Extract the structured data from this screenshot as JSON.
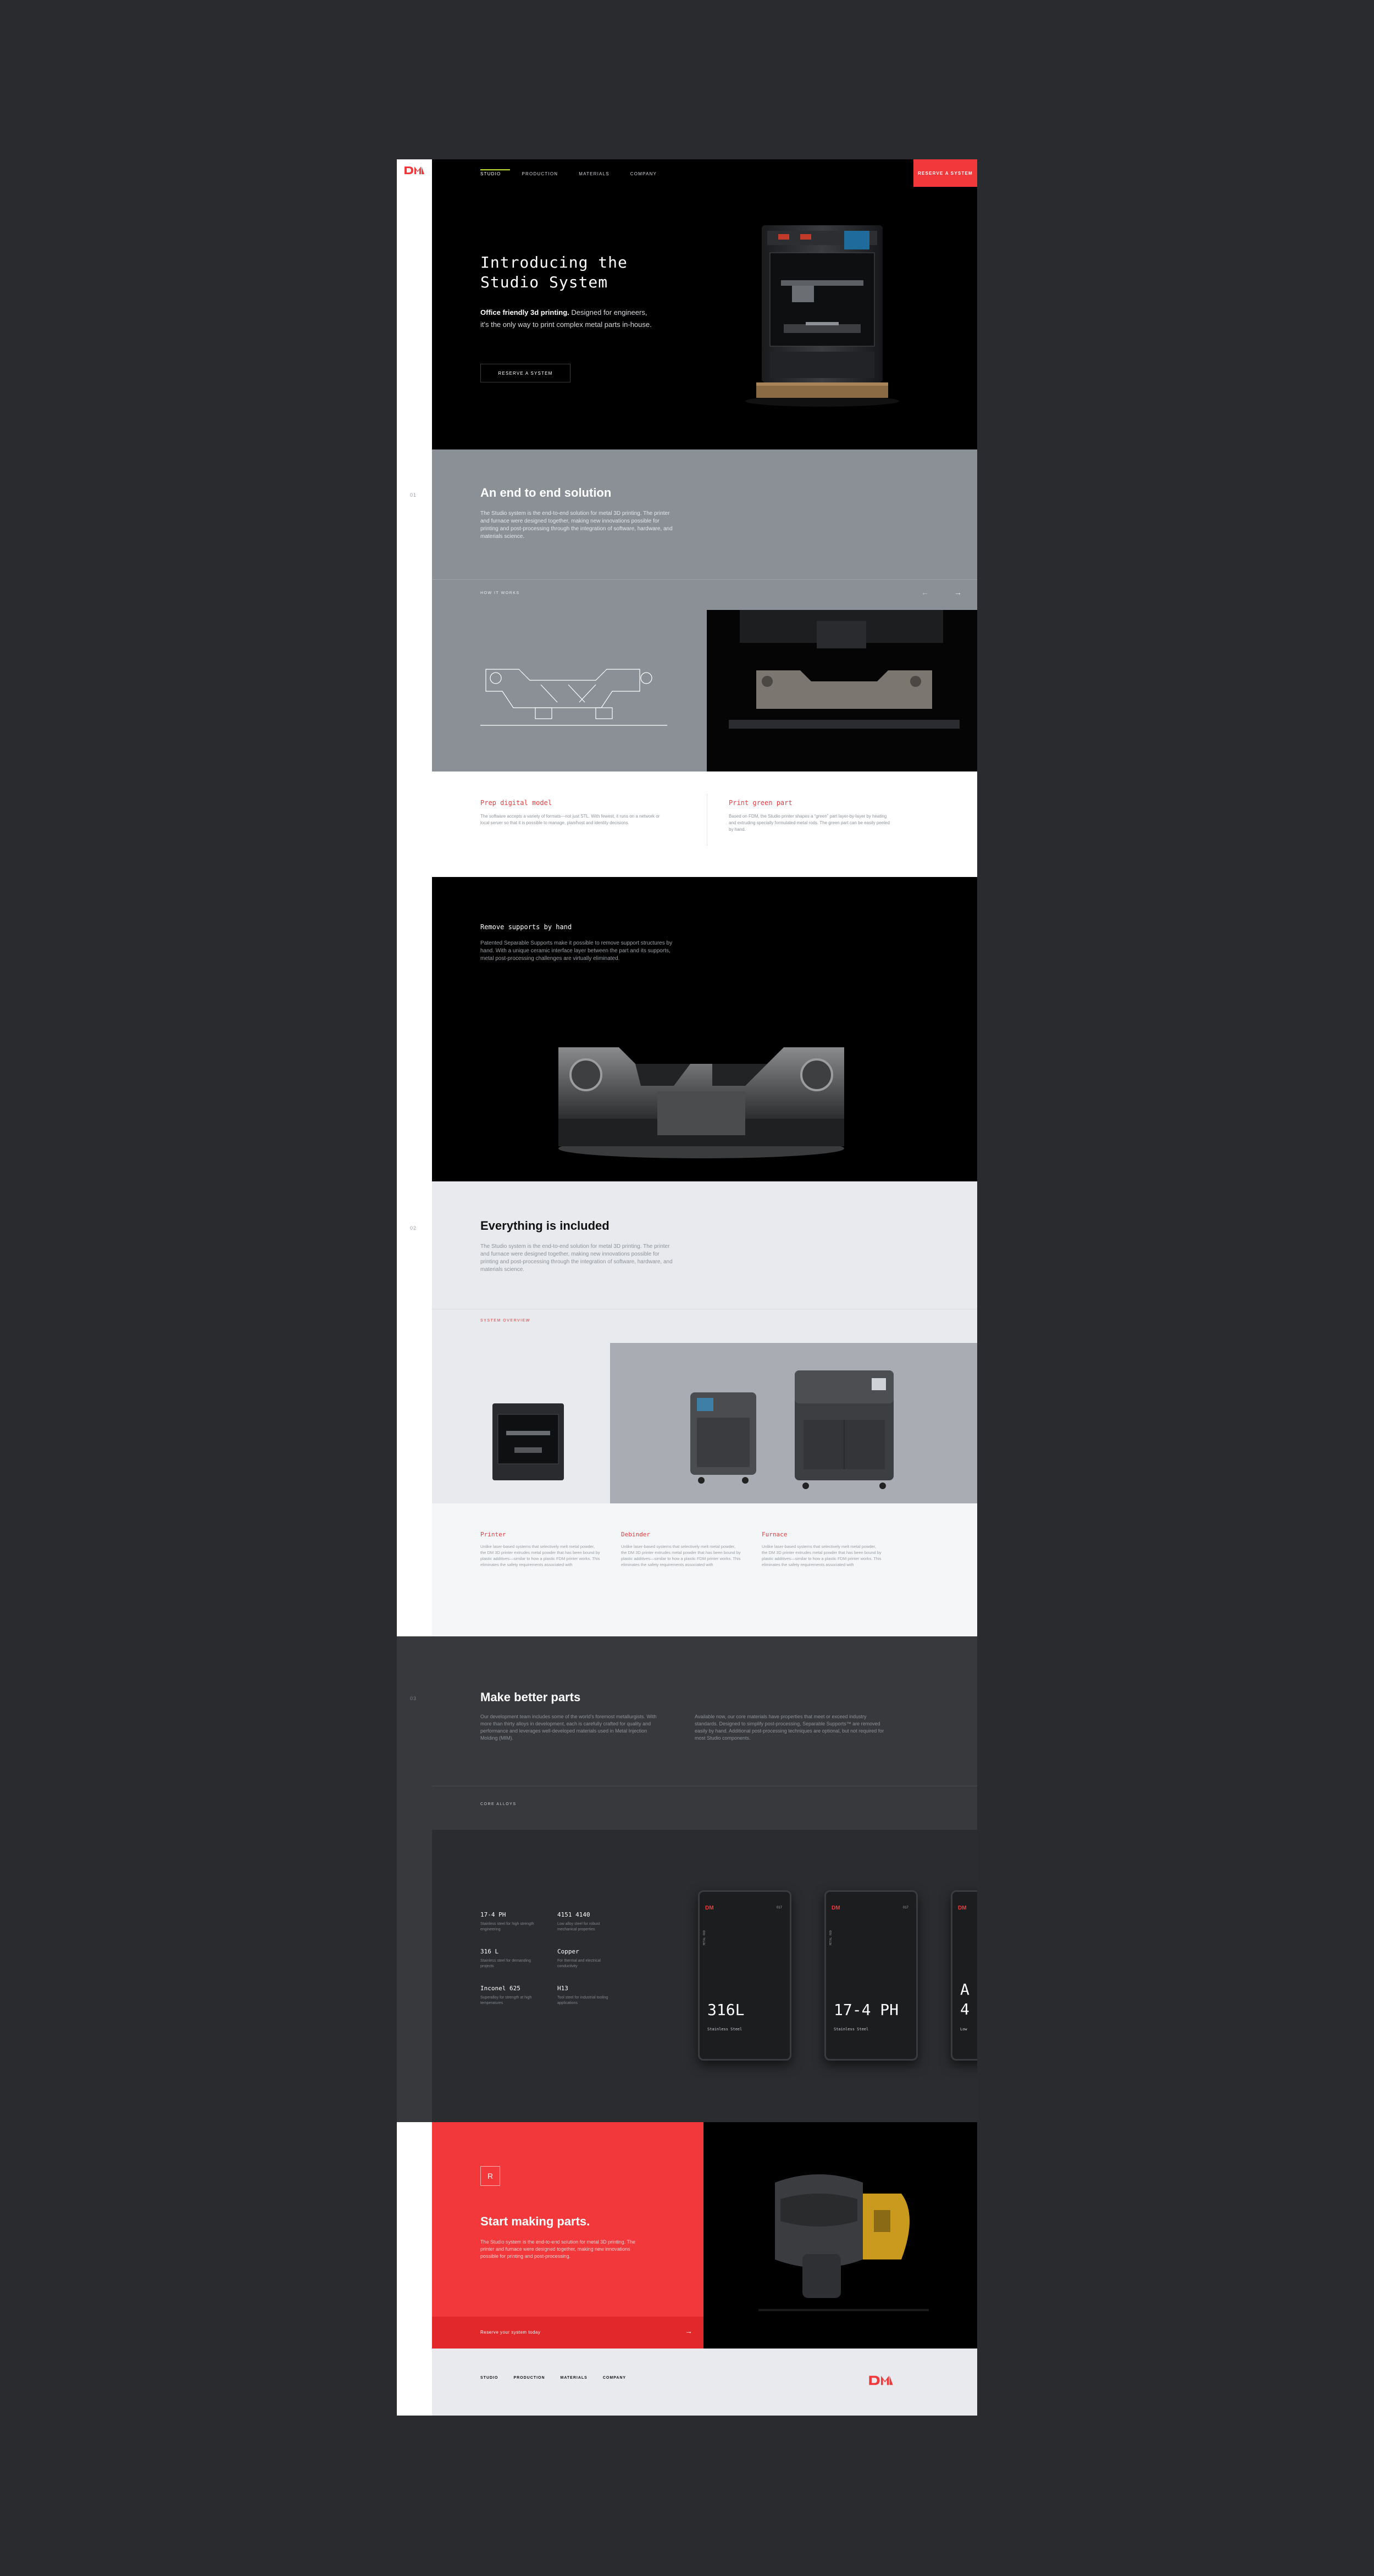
{
  "nav": {
    "logo": "DM",
    "links": [
      "STUDIO",
      "PRODUCTION",
      "MATERIALS",
      "COMPANY"
    ],
    "active": "STUDIO",
    "cta": "RESERVE A SYSTEM"
  },
  "hero": {
    "title_line1": "Introducing the",
    "title_line2": "Studio System",
    "subtitle_bold": "Office friendly 3d printing.",
    "subtitle_rest": " Designed for engineers,",
    "subtitle_line2": "it's the only way to print complex metal parts in-house.",
    "button": "RESERVE A SYSTEM"
  },
  "solution": {
    "num": "01",
    "title": "An end to end solution",
    "text": "The Studio system is the end-to-end solution for metal 3D printing. The printer and furnace were designed together, making new innovations possible for printing and post-processing through the integration of software, hardware, and materials science.",
    "how_it_works": "HOW IT WORKS",
    "steps": [
      {
        "title": "Prep digital model",
        "text": "The software accepts a variety of formats—not just STL. With fewest, it runs on a network or local server so that it is possible to manage, plan/host and identity decisions."
      },
      {
        "title": "Print green part",
        "text": "Based on FDM, the Studio printer shapes a “green” part layer-by-layer by heating and extruding specially formulated metal rods. The green part can be easily peeled by hand."
      }
    ]
  },
  "supports": {
    "title": "Remove supports by hand",
    "text": "Patented Separable Supports make it possible to remove support structures by hand. With a unique ceramic interface layer between the part and its supports, metal post-processing challenges are virtually eliminated."
  },
  "included": {
    "num": "02",
    "title": "Everything is included",
    "text": "The Studio system is the end-to-end solution for metal 3D printing. The printer and furnace were designed together, making new innovations possible for printing and post-processing through the integration of software, hardware, and materials science.",
    "overview_label": "SYSTEM OVERVIEW",
    "products": [
      {
        "title": "Printer",
        "text": "Unlike laser-based systems that selectively melt metal powder, the DM 3D printer extrudes metal powder that has been bound by plastic additives—similar to how a plastic FDM printer works. This eliminates the safety requirements associated with"
      },
      {
        "title": "Debinder",
        "text": "Unlike laser-based systems that selectively melt metal powder, the DM 3D printer extrudes metal powder that has been bound by plastic additives—similar to how a plastic FDM printer works. This eliminates the safety requirements associated with"
      },
      {
        "title": "Furnace",
        "text": "Unlike laser-based systems that selectively melt metal powder, the DM 3D printer extrudes metal powder that has been bound by plastic additives—similar to how a plastic FDM printer works. This eliminates the safety requirements associated with"
      }
    ]
  },
  "parts": {
    "num": "03",
    "title": "Make better parts",
    "text_left": "Our development team includes some of the world's foremost metallurgists. With more than thirty alloys in development, each is carefully crafted for quality and performance and leverages well-developed materials used in Metal Injection Molding (MIM).",
    "text_right": "Available now, our core materials have properties that meet or exceed industry standards. Designed to simplify post-processing, Separable Supports™ are removed easily by hand. Additional post-processing techniques are optional, but not required for most Studio components.",
    "core_label": "CORE ALLOYS",
    "alloys": [
      {
        "name": "17-4 PH",
        "desc": "Stainless steel for high strength engineering"
      },
      {
        "name": "4151 4140",
        "desc": "Low alloy steel for robust mechanical properties"
      },
      {
        "name": "316 L",
        "desc": "Stainless steel for demanding projects"
      },
      {
        "name": "Copper",
        "desc": "For thermal and electrical conductivity"
      },
      {
        "name": "Inconel 625",
        "desc": "Superalloy for strength at high temperatures"
      },
      {
        "name": "H13",
        "desc": "Tool steel for industrial tooling applications"
      }
    ],
    "cards": [
      {
        "name": "316L",
        "sub": "Stainless Steel",
        "side": "METAL ROD",
        "tag": "017"
      },
      {
        "name": "17-4 PH",
        "sub": "Stainless Steel",
        "side": "METAL ROD",
        "tag": "017"
      },
      {
        "name": "A\n4",
        "sub": "Low",
        "side": "METAL ROD",
        "tag": ""
      }
    ]
  },
  "cta": {
    "badge": "R",
    "title": "Start making parts.",
    "text": "The Studio system is the end-to-end solution for metal 3D printing. The printer and furnace were designed together, making new innovations possible for printing and post-processing.",
    "link": "Reserve your system today",
    "arrow": "→"
  },
  "footer": {
    "links": [
      "STUDIO",
      "PRODUCTION",
      "MATERIALS",
      "COMPANY"
    ],
    "logo": "DM"
  },
  "colors": {
    "accent": "#f2383a",
    "lime": "#c6e236",
    "dark": "#38393d",
    "steel": "#8b9097"
  }
}
